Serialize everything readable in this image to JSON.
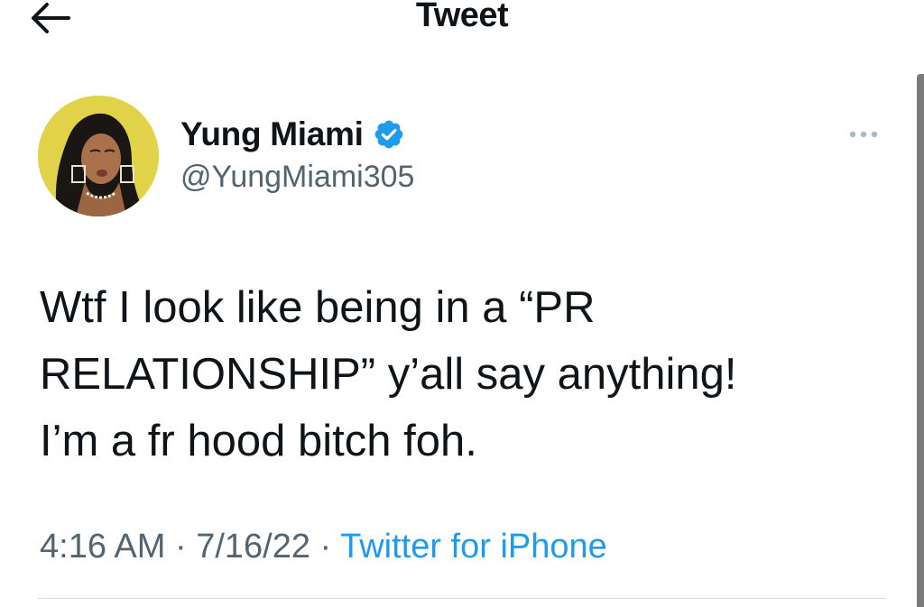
{
  "header": {
    "title": "Tweet",
    "back_icon": "arrow-left-icon"
  },
  "tweet": {
    "author": {
      "display_name": "Yung Miami",
      "handle": "@YungMiami305",
      "verified": true,
      "verified_icon": "verified-badge-icon",
      "verified_color": "#1d9bf0"
    },
    "more_icon": "more-horizontal-icon",
    "text": "Wtf I look like being in a “PR\nRELATIONSHIP” y’all say anything!\nI’m a fr hood bitch foh.",
    "time": "4:16 AM",
    "separator": " · ",
    "date": "7/16/22",
    "source": "Twitter for iPhone",
    "source_color": "#1d9bf0"
  },
  "colors": {
    "text_primary": "#0f1419",
    "text_secondary": "#536471",
    "avatar_background": "#e2d24a"
  }
}
